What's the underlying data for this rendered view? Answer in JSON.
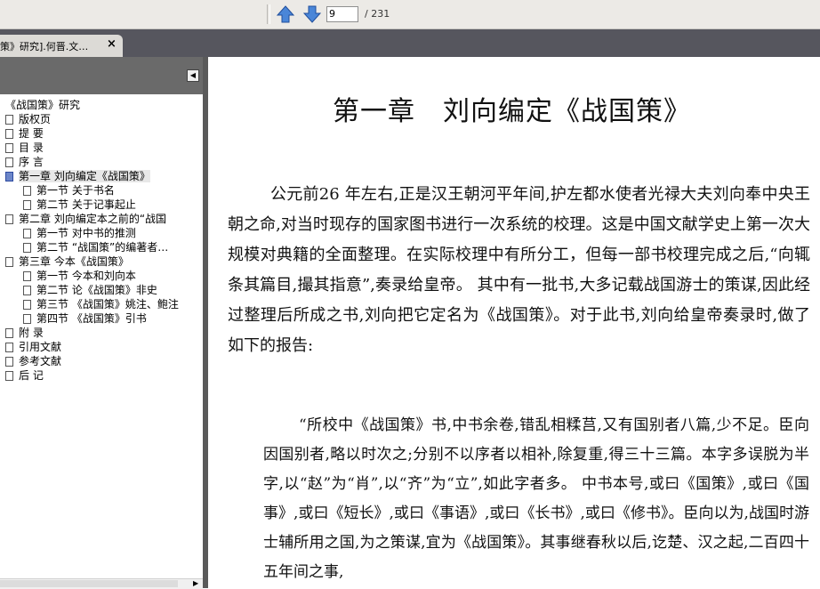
{
  "toolbar": {
    "page_current": "9",
    "page_total": "/ 231"
  },
  "tab": {
    "title": "策》研究].何晋.文…",
    "close": "×"
  },
  "sidebar": {
    "items": [
      {
        "label": "《战国策》研究"
      },
      {
        "label": "版权页"
      },
      {
        "label": "提 要"
      },
      {
        "label": "目 录"
      },
      {
        "label": "序 言"
      },
      {
        "label": "第一章 刘向编定《战国策》"
      },
      {
        "label": "第一节 关于书名"
      },
      {
        "label": "第二节 关于记事起止"
      },
      {
        "label": "第二章 刘向编定本之前的“战国"
      },
      {
        "label": "第一节 对中书的推测"
      },
      {
        "label": "第二节 “战国策”的编著者…"
      },
      {
        "label": "第三章 今本《战国策》"
      },
      {
        "label": "第一节 今本和刘向本"
      },
      {
        "label": "第二节 论《战国策》非史"
      },
      {
        "label": "第三节 《战国策》姚注、鲍注"
      },
      {
        "label": "第四节 《战国策》引书"
      },
      {
        "label": "附 录"
      },
      {
        "label": "引用文献"
      },
      {
        "label": "参考文献"
      },
      {
        "label": "后 记"
      }
    ]
  },
  "document": {
    "chapter_title": "第一章　刘向编定《战国策》",
    "paragraph": "公元前26 年左右,正是汉王朝河平年间,护左都水使者光禄大夫刘向奉中央王朝之命,对当时现存的国家图书进行一次系统的校理。这是中国文献学史上第一次大规模对典籍的全面整理。在实际校理中有所分工，但每一部书校理完成之后,“向辄条其篇目,撮其指意”,奏录给皇帝。 其中有一批书,大多记载战国游士的策谋,因此经过整理后所成之书,刘向把它定名为《战国策》。对于此书,刘向给皇帝奏录时,做了如下的报告:",
    "quote": "“所校中《战国策》书,中书余卷,错乱相糅莒,又有国别者八篇,少不足。臣向因国别者,略以时次之;分别不以序者以相补,除复重,得三十三篇。本字多误脱为半字,以“赵”为“肖”,以“齐”为“立”,如此字者多。 中书本号,或曰《国策》,或曰《国事》,或曰《短长》,或曰《事语》,或曰《长书》,或曰《修书》。臣向以为,战国时游士辅所用之国,为之策谋,宜为《战国策》。其事继春秋以后,讫楚、汉之起,二百四十五年间之事,"
  }
}
